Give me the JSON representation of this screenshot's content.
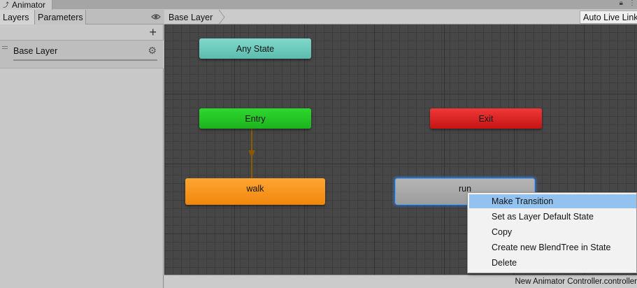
{
  "window": {
    "tab_title": "Animator",
    "tab_icon": "animator-icon",
    "lock_icon": "lock-icon",
    "more_icon": "kebab-menu-icon"
  },
  "left_panel": {
    "tabs": [
      {
        "label": "Layers",
        "active": true
      },
      {
        "label": "Parameters",
        "active": false
      }
    ],
    "eye_icon": "eye-icon",
    "add_glyph": "+",
    "layers": [
      {
        "name": "Base Layer",
        "gear_icon": "gear-icon"
      }
    ]
  },
  "graph": {
    "breadcrumb": "Base Layer",
    "live_link_label": "Auto Live Link",
    "states": {
      "any_state": "Any State",
      "entry": "Entry",
      "exit": "Exit",
      "walk": "walk",
      "run": "run"
    },
    "colors": {
      "any_state": "#6ccbbd",
      "entry": "#22c722",
      "exit": "#dc2222",
      "walk_default": "#f5901e",
      "run": "#a8a8a8",
      "selection": "#3f8ae6",
      "transition": "#8b5a00"
    },
    "status_text": "New Animator Controller.controller"
  },
  "context_menu": {
    "items": [
      {
        "label": "Make Transition",
        "highlighted": true
      },
      {
        "label": "Set as Layer Default State",
        "highlighted": false
      },
      {
        "label": "Copy",
        "highlighted": false
      },
      {
        "label": "Create new BlendTree in State",
        "highlighted": false
      },
      {
        "label": "Delete",
        "highlighted": false
      }
    ]
  }
}
